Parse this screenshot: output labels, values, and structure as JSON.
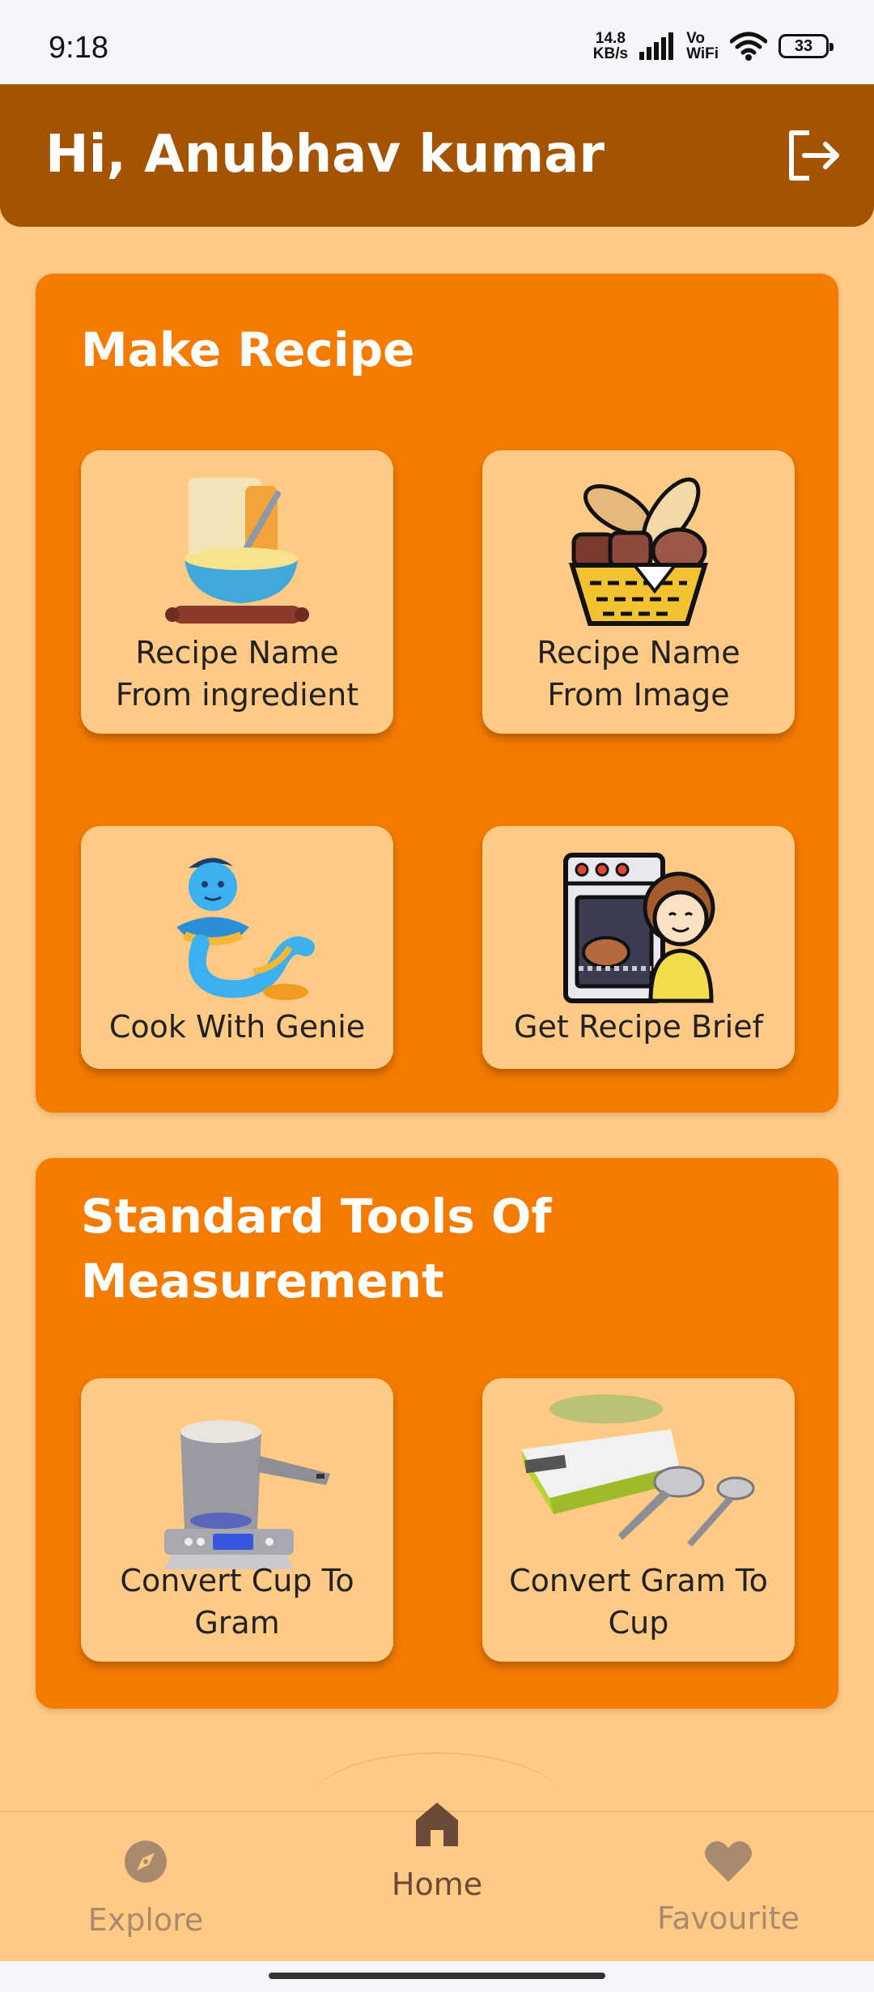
{
  "status_bar": {
    "time": "9:18",
    "net_speed_value": "14.8",
    "net_speed_unit": "KB/s",
    "vowifi_top": "Vo",
    "vowifi_bottom": "WiFi",
    "battery": "33"
  },
  "header": {
    "greeting": "Hi, Anubhav kumar"
  },
  "make_recipe": {
    "title": "Make Recipe",
    "tiles": [
      {
        "line1": "Recipe Name",
        "line2": "From ingredient",
        "icon": "mixing-bowl-icon"
      },
      {
        "line1": "Recipe Name",
        "line2": "From Image",
        "icon": "bread-basket-icon"
      },
      {
        "line1": "Cook With Genie",
        "line2": "",
        "icon": "genie-icon"
      },
      {
        "line1": "Get Recipe Brief",
        "line2": "",
        "icon": "chef-oven-icon"
      }
    ]
  },
  "measurement": {
    "title_line1": "Standard Tools Of",
    "title_line2": "Measurement",
    "tiles": [
      {
        "line1": "Convert Cup To",
        "line2": "Gram",
        "icon": "cup-on-scale-icon"
      },
      {
        "line1": "Convert Gram To",
        "line2": "Cup",
        "icon": "scale-and-spoons-icon"
      }
    ]
  },
  "bottom_nav": {
    "explore": "Explore",
    "home": "Home",
    "favourite": "Favourite"
  },
  "colors": {
    "header": "#A45300",
    "card": "#F47B00",
    "background": "#FFCA85",
    "nav_inactive": "#A98A6E",
    "nav_active": "#6B4A3A"
  }
}
